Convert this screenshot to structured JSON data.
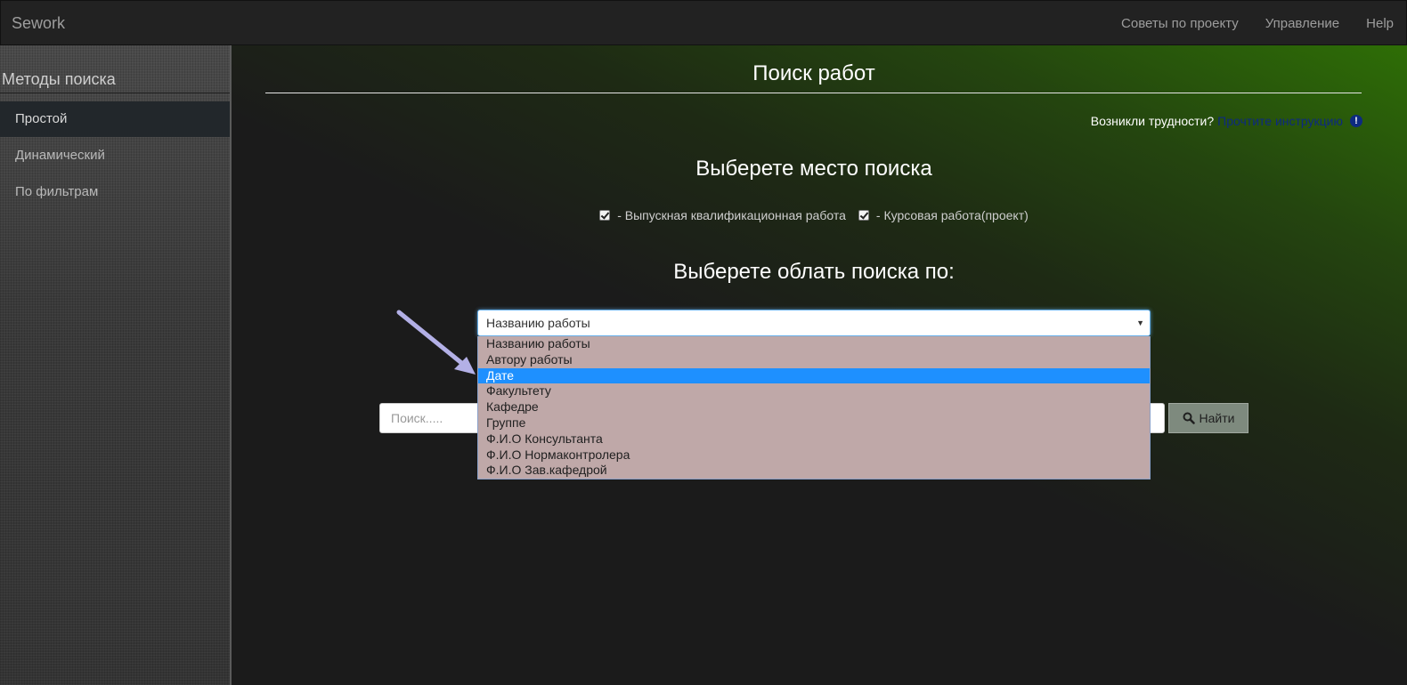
{
  "navbar": {
    "brand": "Sework",
    "links": [
      "Советы по проекту",
      "Управление",
      "Help"
    ]
  },
  "sidebar": {
    "title": "Методы поиска",
    "items": [
      {
        "label": "Простой",
        "active": true
      },
      {
        "label": "Динамический",
        "active": false
      },
      {
        "label": "По фильтрам",
        "active": false
      }
    ]
  },
  "main": {
    "title": "Поиск работ",
    "help_text": "Возникли трудности?",
    "help_link": "Прочтите инструкцию",
    "place_heading": "Выберете место поиска",
    "checkboxes": [
      {
        "label": "- Выпускная квалификационная работа",
        "checked": true
      },
      {
        "label": "- Курсовая работа(проект)",
        "checked": true
      }
    ],
    "area_heading": "Выберете облать поиска по:",
    "select": {
      "value": "Названию работы",
      "options": [
        "Названию работы",
        "Автору работы",
        "Дате",
        "Факультету",
        "Кафедре",
        "Группе",
        "Ф.И.О Консультанта",
        "Ф.И.О Нормаконтролера",
        "Ф.И.О Зав.кафедрой"
      ],
      "highlighted": "Дате"
    },
    "search": {
      "placeholder": "Поиск.....",
      "button_label": "Найти"
    }
  },
  "colors": {
    "accent_green": "#2e6e06",
    "highlight_blue": "#1e90ff",
    "dropdown_bg": "#bfa8a8",
    "link_blue": "#0d2a80"
  }
}
